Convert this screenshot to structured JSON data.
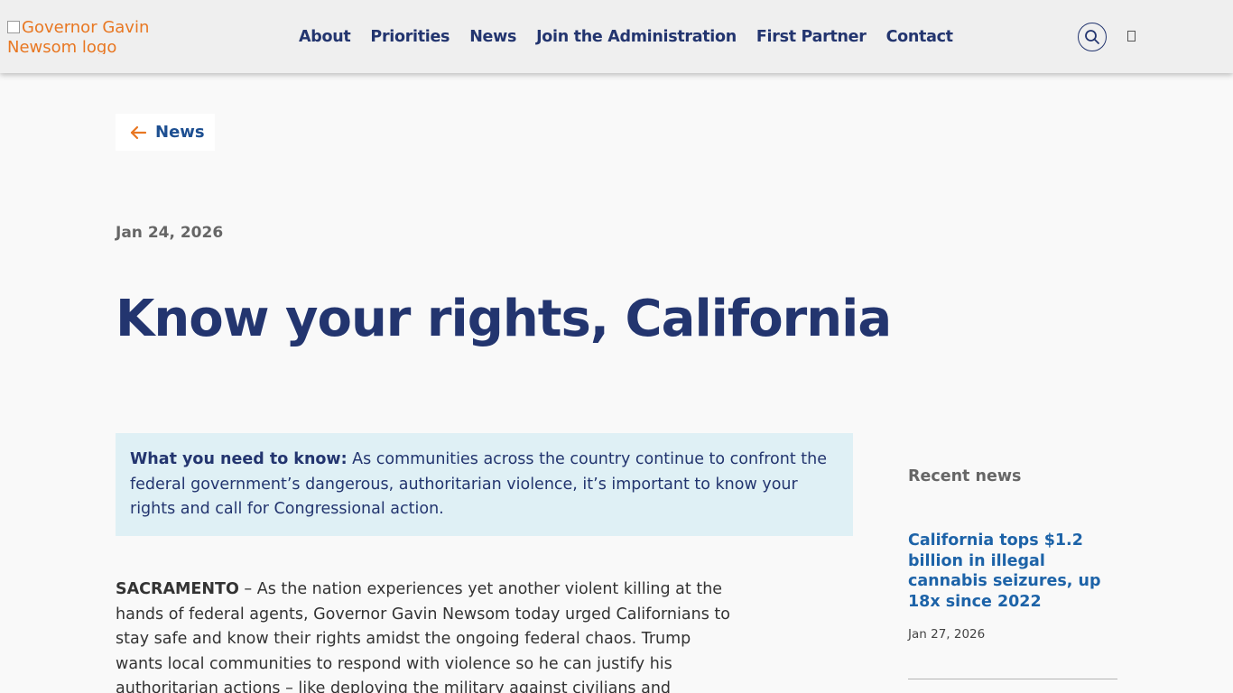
{
  "header": {
    "logo_alt": "Governor Gavin Newsom logo",
    "nav": [
      "About",
      "Priorities",
      "News",
      "Join the Administration",
      "First Partner",
      "Contact"
    ],
    "search_icon": "search-icon",
    "menu_icon": "menu-icon"
  },
  "back_link": {
    "label": "News",
    "icon": "arrow-left-icon",
    "color": "#e87722"
  },
  "article": {
    "date": "Jan 24, 2026",
    "title": "Know your rights, California",
    "callout_lead": "What you need to know:",
    "callout_text": " As communities across the country continue to confront the federal government’s dangerous, authoritarian violence, it’s important to know your rights and call for Congressional action.",
    "dateline": "SACRAMENTO",
    "body": " – As the nation experiences yet another violent killing at the hands of federal agents, Governor Gavin Newsom today urged Californians to stay safe and know their rights amidst the ongoing federal chaos. Trump wants local communities to respond with violence so he can justify his authoritarian actions – like deploying the military against civilians and"
  },
  "sidebar": {
    "heading": "Recent news",
    "items": [
      {
        "title": "California tops $1.2 billion in illegal cannabis seizures, up 18x since 2022",
        "date": "Jan 27, 2026"
      }
    ]
  },
  "colors": {
    "navy": "#23356f",
    "link_blue": "#1d63a8",
    "accent_orange": "#e87722",
    "callout_bg": "#dff0f5"
  }
}
